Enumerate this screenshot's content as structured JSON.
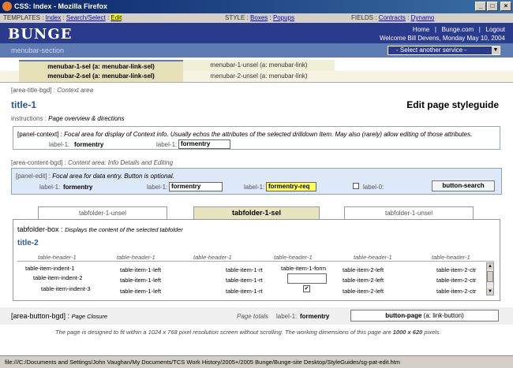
{
  "window": {
    "title": "CSS: Index - Mozilla Firefox"
  },
  "templates_bar": {
    "templates_label": "TEMPLATES :",
    "index": "Index",
    "search": "Search/Select",
    "edit": "Edit",
    "style_label": "STYLE :",
    "boxes": "Boxes",
    "popups": "Popups",
    "fields_label": "FIELDS :",
    "contracts": "Contracts",
    "dynamo": "Dynamo"
  },
  "header": {
    "logo": "BUNGE",
    "links": [
      "Home",
      "Bunge.com",
      "Logout"
    ],
    "welcome": "Welcome Bill Devens, Monday May 10, 2004"
  },
  "menu_section": {
    "label": "menubar-section",
    "service_select": "- Select another service -"
  },
  "menubar1": {
    "sel": "menubar-1-sel (a: menubar-link-sel)",
    "unsel": "menubar-1-unsel (a: menubar-link)"
  },
  "menubar2": {
    "sel": "menubar-2-sel (a: menubar-link-sel)",
    "unsel": "menubar-2-unsel (a: menubar-link)"
  },
  "title_area": {
    "tag": "[area-title-bgd] :",
    "tag_desc": "Context area",
    "title": "title-1",
    "page_title": "Edit page styleguide",
    "instr_label": "instructions :",
    "instr_text": "Page overview & directions"
  },
  "panel_context": {
    "tag": "[panel-context] :",
    "desc": "Focal area for display of Context info. Usually echos the attributes of the selected drilldown Item. May also (rarely) allow editing of those attributes.",
    "label1": "label-1:",
    "value1": "formentry",
    "label2": "label-1:",
    "value2": "formentry"
  },
  "content_area": {
    "tag": "[area-content-bgd] :",
    "tag_desc": "Content area: Info Details and Editing"
  },
  "panel_edit": {
    "tag": "[panel-edit] :",
    "desc": "Focal area for data entry. Button is optional.",
    "l1": "label-1:",
    "v1": "formentry",
    "l2": "label-1:",
    "v2": "formentry",
    "l3": "label-1:",
    "v3": "formentry-req",
    "l4": "label-0:",
    "button": "button-search"
  },
  "tabfolders": {
    "left": "tabfolder-1-unsel",
    "center": "tabfolder-1-sel",
    "right": "tabfolder-1-unsel"
  },
  "tabbox": {
    "title": "tabfolder-box :",
    "desc": "Displays the content of the selected tabfolder",
    "title2": "title-2"
  },
  "table": {
    "headers": [
      "table-header-1",
      "table-header-1",
      "table-header-1",
      "table-header-1",
      "table-header-1",
      "table-header-1"
    ],
    "rows": [
      [
        "table-item-indent-1",
        "table-item-1-left",
        "table-item-1-rt",
        "table-item-1-form",
        "table-item-2-left",
        "table-item-2-ctr"
      ],
      [
        "table-item-indent-2",
        "table-item-1-left",
        "table-item-1-rt",
        "",
        "table-item-2-left",
        "table-item-2-ctr"
      ],
      [
        "table-item-indent-3",
        "table-item-1-left",
        "table-item-1-rt",
        "✔",
        "table-item-2-left",
        "table-item-2-ctr"
      ]
    ]
  },
  "button_area": {
    "tag": "[area-button-bgd] :",
    "tag_desc": "Page Closure",
    "totals_label": "Page totals",
    "label": "label-1:",
    "value": "formentry",
    "button": "button-page",
    "button_note": "(a: link-button)"
  },
  "footer": {
    "note1": "The page is designed to fit within a 1024 x 768 pixel resolution screen without scrolling. The working dimensions of this page are",
    "dims": "1000 x 620",
    "note2": "pixels."
  },
  "status": {
    "text": "file:///C:/Documents and Settings/John Vaughan/My Documents/TCS Work History/2005+/2005 Bunge/Bunge-site Desktop/StyleGuides/sg-pat-edit.htm"
  },
  "colors": {
    "header_bg": "#2a3a8c",
    "menu_section_bg": "#5e7bb3",
    "tab_sel_bg": "#e8e4c0",
    "edit_panel_bg": "#dde8f8",
    "req_field": "#ffff55"
  }
}
